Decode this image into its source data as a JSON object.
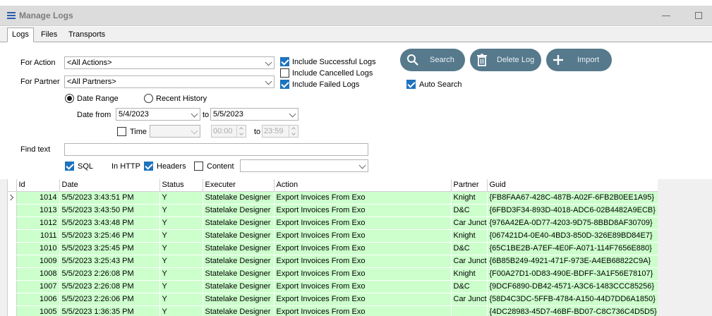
{
  "window": {
    "title": "Manage Logs"
  },
  "tabs": [
    {
      "label": "Logs",
      "active": true
    },
    {
      "label": "Files",
      "active": false
    },
    {
      "label": "Transports",
      "active": false
    }
  ],
  "filters": {
    "for_action_label": "For Action",
    "for_action_value": "<All Actions>",
    "for_partner_label": "For Partner",
    "for_partner_value": "<All Partners>",
    "include_successful": {
      "label": "Include Successful Logs",
      "checked": true
    },
    "include_cancelled": {
      "label": "Include Cancelled Logs",
      "checked": false
    },
    "include_failed": {
      "label": "Include Failed Logs",
      "checked": true
    },
    "auto_search": {
      "label": "Auto Search",
      "checked": true
    },
    "date_range_label": "Date Range",
    "recent_history_label": "Recent History",
    "date_from_label": "Date from",
    "date_from_value": "5/4/2023",
    "to_label": "to",
    "date_to_value": "5/5/2023",
    "time_label": "Time",
    "time_from_value": "00:00",
    "time_to_value": "23:59",
    "find_text_label": "Find text",
    "find_text_value": "",
    "sql_label": "SQL",
    "in_http_label": "In HTTP",
    "headers_label": "Headers",
    "content_label": "Content"
  },
  "buttons": {
    "search": "Search",
    "delete_log": "Delete Log",
    "import": "Import"
  },
  "colors": {
    "accent": "#56798c",
    "row_success": "#ccffcc",
    "checkbox": "#1e73be"
  },
  "table": {
    "columns": [
      "Id",
      "Date",
      "Status",
      "Executer",
      "Action",
      "Partner",
      "Guid"
    ],
    "rows": [
      [
        "1014",
        "5/5/2023 3:43:51 PM",
        "Y",
        "Statelake Designer",
        "Export Invoices From Exo",
        "Knight",
        "{FB8FAA67-428C-487B-A02F-6FB2B0EE1A95}"
      ],
      [
        "1013",
        "5/5/2023 3:43:50 PM",
        "Y",
        "Statelake Designer",
        "Export Invoices From Exo",
        "D&C",
        "{6FBD3F34-893D-4018-ADC6-02B4482A9ECB}"
      ],
      [
        "1012",
        "5/5/2023 3:43:48 PM",
        "Y",
        "Statelake Designer",
        "Export Invoices From Exo",
        "Car Juncti",
        "{976A42EA-0D77-4203-9D75-8BBD8AF30709}"
      ],
      [
        "1011",
        "5/5/2023 3:25:46 PM",
        "Y",
        "Statelake Designer",
        "Export Invoices From Exo",
        "Knight",
        "{067421D4-0E40-4BD3-850D-326E89BD84E7}"
      ],
      [
        "1010",
        "5/5/2023 3:25:45 PM",
        "Y",
        "Statelake Designer",
        "Export Invoices From Exo",
        "D&C",
        "{65C1BE2B-A7EF-4E0F-A071-114F7656E880}"
      ],
      [
        "1009",
        "5/5/2023 3:25:43 PM",
        "Y",
        "Statelake Designer",
        "Export Invoices From Exo",
        "Car Juncti",
        "{6B85B249-4921-471F-973E-A4EB68822C9A}"
      ],
      [
        "1008",
        "5/5/2023 2:26:08 PM",
        "Y",
        "Statelake Designer",
        "Export Invoices From Exo",
        "Knight",
        "{F00A27D1-0D83-490E-BDFF-3A1F56E78107}"
      ],
      [
        "1007",
        "5/5/2023 2:26:08 PM",
        "Y",
        "Statelake Designer",
        "Export Invoices From Exo",
        "D&C",
        "{9DCF6890-DB42-4571-A3C6-1483CCC85256}"
      ],
      [
        "1006",
        "5/5/2023 2:26:06 PM",
        "Y",
        "Statelake Designer",
        "Export Invoices From Exo",
        "Car Juncti",
        "{58D4C3DC-5FFB-4784-A150-44D7DD6A1850}"
      ],
      [
        "1005",
        "5/5/2023 1:36:35 PM",
        "Y",
        "Statelake Designer",
        "Export Invoices From Exo",
        "",
        "{4DC28983-45D7-46BF-BD07-C8C736C4D5D5}"
      ]
    ]
  }
}
